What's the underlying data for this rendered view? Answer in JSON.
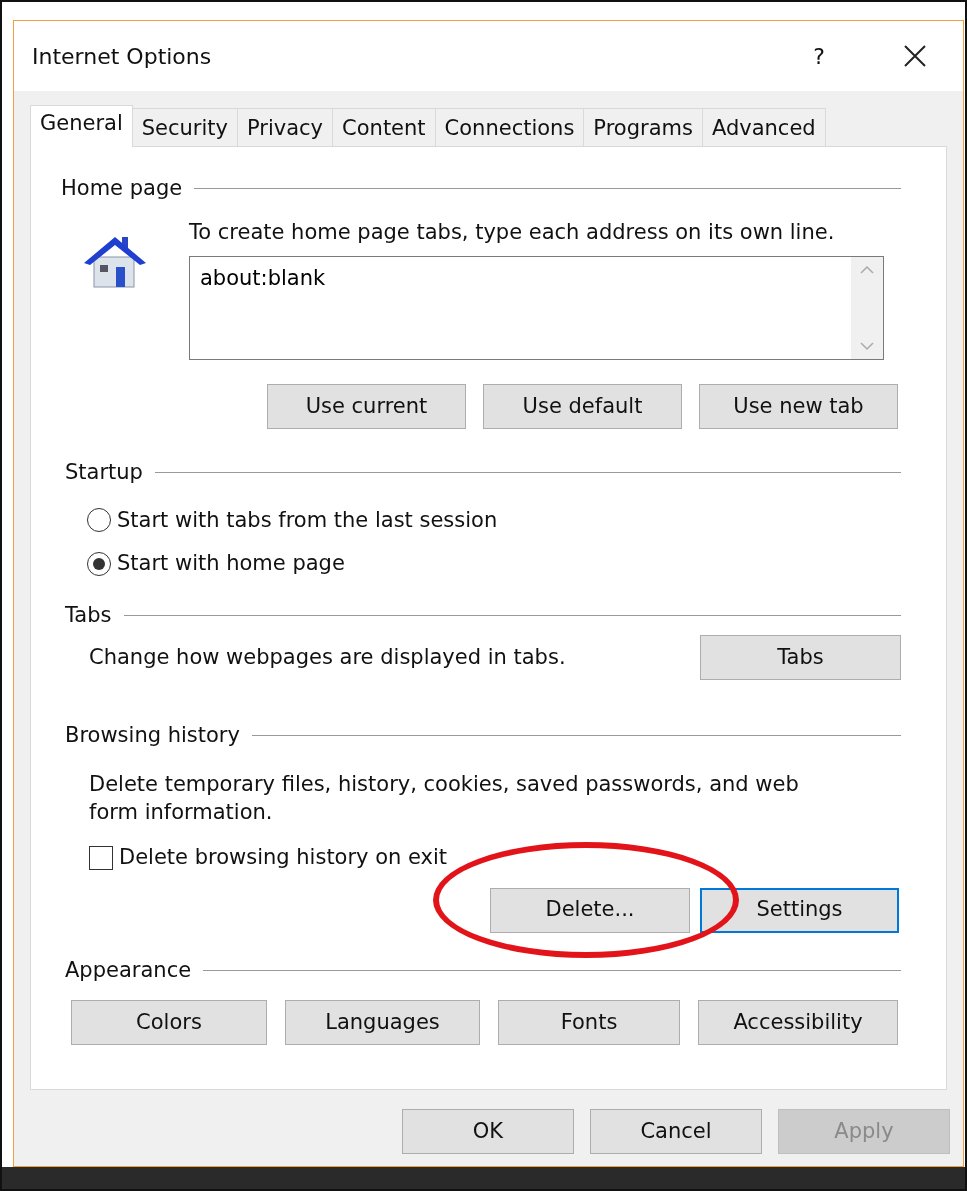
{
  "window": {
    "title": "Internet Options",
    "help": "?"
  },
  "tabs": [
    {
      "label": "General",
      "selected": true
    },
    {
      "label": "Security",
      "selected": false
    },
    {
      "label": "Privacy",
      "selected": false
    },
    {
      "label": "Content",
      "selected": false
    },
    {
      "label": "Connections",
      "selected": false
    },
    {
      "label": "Programs",
      "selected": false
    },
    {
      "label": "Advanced",
      "selected": false
    }
  ],
  "home_page": {
    "title": "Home page",
    "instruction": "To create home page tabs, type each address on its own line.",
    "addresses": "about:blank",
    "buttons": [
      "Use current",
      "Use default",
      "Use new tab"
    ]
  },
  "startup": {
    "title": "Startup",
    "options": [
      {
        "label": "Start with tabs from the last session",
        "selected": false
      },
      {
        "label": "Start with home page",
        "selected": true
      }
    ]
  },
  "tabs_section": {
    "title": "Tabs",
    "description": "Change how webpages are displayed in tabs.",
    "button": "Tabs"
  },
  "browsing_history": {
    "title": "Browsing history",
    "description": "Delete temporary files, history, cookies, saved passwords, and web form information.",
    "delete_on_exit": {
      "label": "Delete browsing history on exit",
      "checked": false
    },
    "buttons": [
      {
        "label": "Delete...",
        "focused": false,
        "highlighted": true
      },
      {
        "label": "Settings",
        "focused": true,
        "highlighted": false
      }
    ]
  },
  "appearance": {
    "title": "Appearance",
    "buttons": [
      "Colors",
      "Languages",
      "Fonts",
      "Accessibility"
    ]
  },
  "footer_buttons": [
    {
      "label": "OK",
      "disabled": false
    },
    {
      "label": "Cancel",
      "disabled": false
    },
    {
      "label": "Apply",
      "disabled": true
    }
  ]
}
